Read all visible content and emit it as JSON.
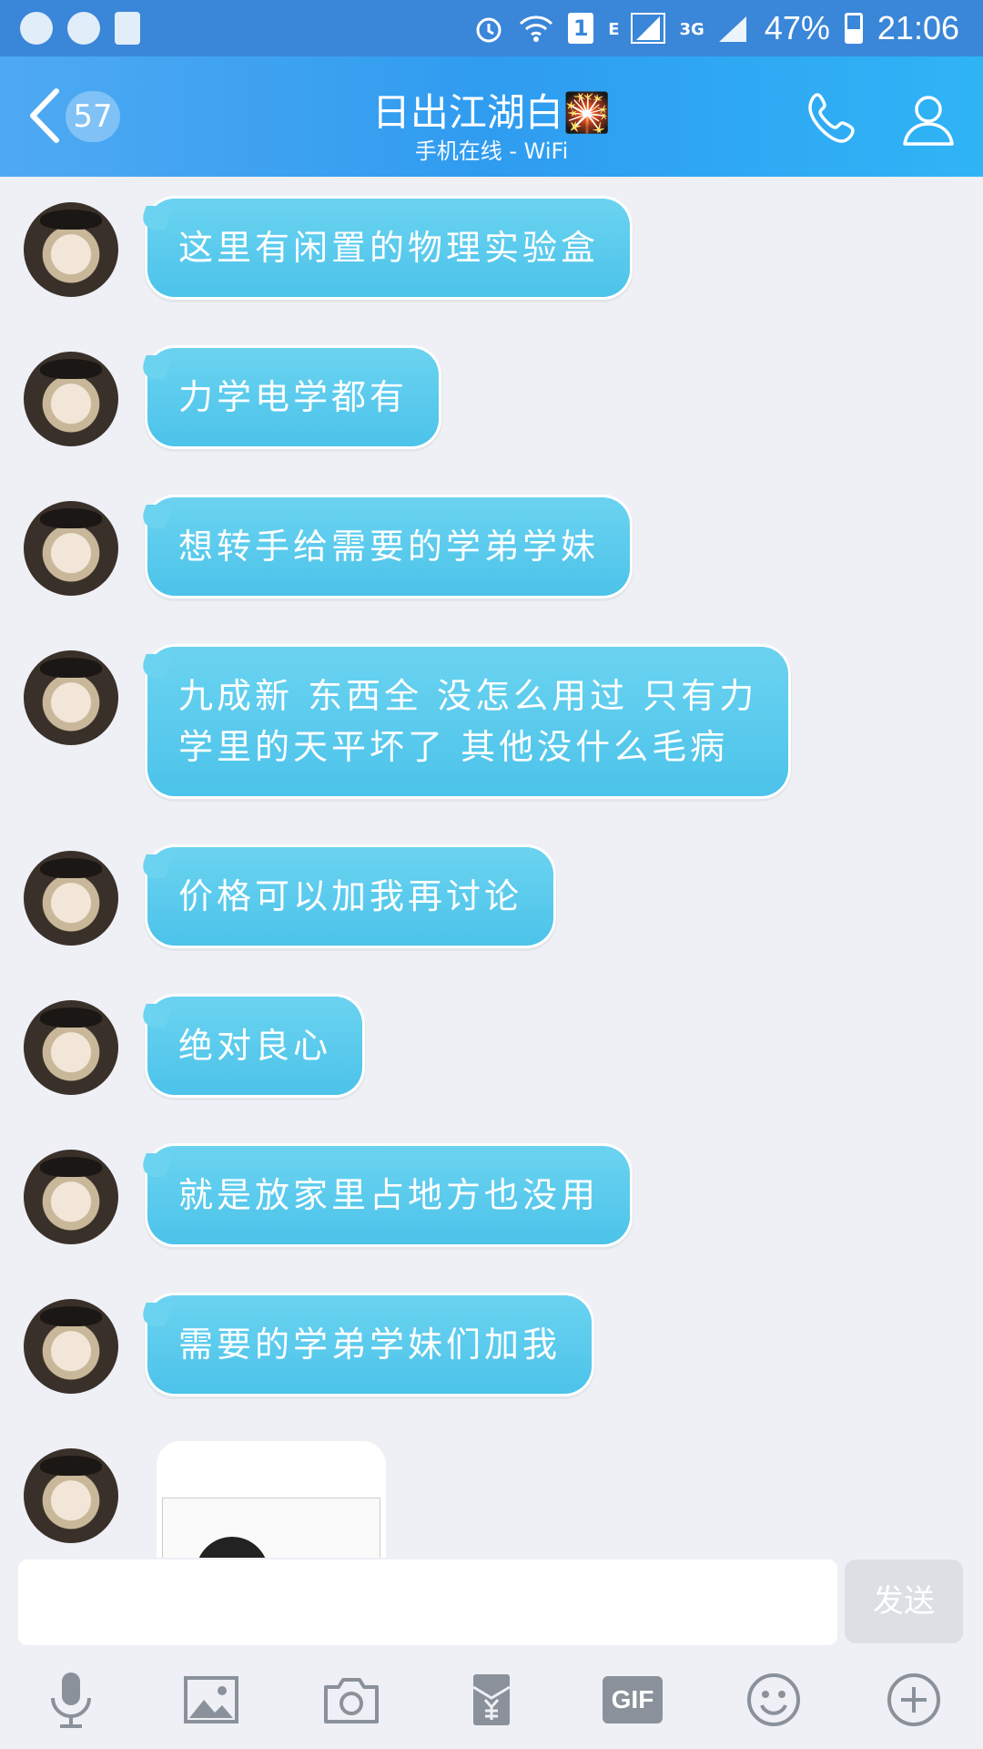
{
  "status_bar": {
    "sim_slot": "1",
    "network_e": "E",
    "network_3g": "3G",
    "battery_percent": "47%",
    "time": "21:06"
  },
  "header": {
    "unread_count": "57",
    "contact_name": "日出江湖白🎇",
    "status": "手机在线 - WiFi"
  },
  "messages": [
    {
      "text": "这里有闲置的物理实验盒"
    },
    {
      "text": "力学电学都有"
    },
    {
      "text": "想转手给需要的学弟学妹"
    },
    {
      "text": "九成新 东西全 没怎么用过 只有力\n学里的天平坏了 其他没什么毛病"
    },
    {
      "text": "价格可以加我再讨论"
    },
    {
      "text": "绝对良心"
    },
    {
      "text": "就是放家里占地方也没用"
    },
    {
      "text": "需要的学弟学妹们加我"
    }
  ],
  "composer": {
    "send_label": "发送",
    "gif_label": "GIF"
  },
  "colors": {
    "header_blue": "#2f9cf0",
    "bubble_blue": "#4cc3ea"
  }
}
